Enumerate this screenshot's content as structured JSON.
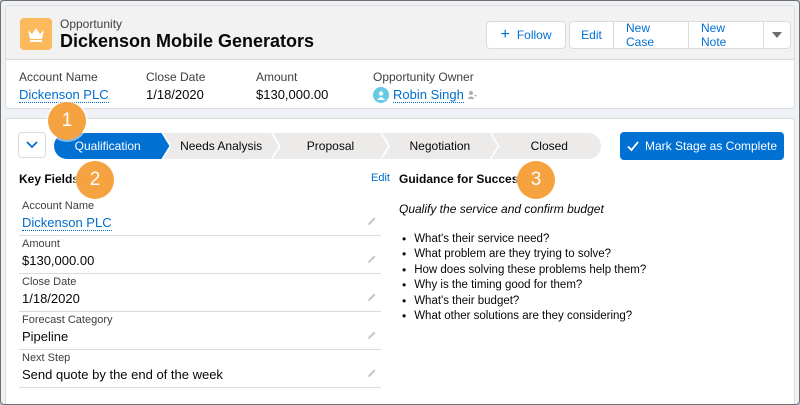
{
  "header": {
    "object_label": "Opportunity",
    "record_title": "Dickenson Mobile Generators",
    "buttons": {
      "follow": "Follow",
      "edit": "Edit",
      "new_case": "New Case",
      "new_note": "New Note"
    },
    "fields": {
      "account_name_label": "Account Name",
      "account_name_value": "Dickenson PLC",
      "close_date_label": "Close Date",
      "close_date_value": "1/18/2020",
      "amount_label": "Amount",
      "amount_value": "$130,000.00",
      "owner_label": "Opportunity Owner",
      "owner_value": "Robin Singh"
    }
  },
  "path": {
    "stages": [
      "Qualification",
      "Needs Analysis",
      "Proposal",
      "Negotiation",
      "Closed"
    ],
    "active_index": 0,
    "mark_complete_label": "Mark Stage as Complete"
  },
  "key_fields": {
    "title": "Key Fields",
    "edit_label": "Edit",
    "items": [
      {
        "label": "Account Name",
        "value": "Dickenson PLC"
      },
      {
        "label": "Amount",
        "value": "$130,000.00"
      },
      {
        "label": "Close Date",
        "value": "1/18/2020"
      },
      {
        "label": "Forecast Category",
        "value": "Pipeline"
      },
      {
        "label": "Next Step",
        "value": "Send quote by the end of the week"
      }
    ]
  },
  "guidance": {
    "title": "Guidance for Success",
    "intro": "Qualify the service and confirm budget",
    "items": [
      "What's their service need?",
      "What problem are they trying to solve?",
      "How does solving these problems help them?",
      "Why is the timing good for them?",
      "What's their budget?",
      "What other solutions are they considering?"
    ]
  },
  "callouts": [
    "1",
    "2",
    "3"
  ],
  "colors": {
    "brand": "#0070d2",
    "active_stage": "#0070d2",
    "inactive_stage": "#ecebea",
    "callout": "#f5a340",
    "app_icon": "#fcb95b",
    "link": "#006dcc"
  },
  "icons": {
    "app_icon": "crown-icon",
    "follow": "plus-icon",
    "more": "chevron-down-icon",
    "collapse": "chevron-down-icon",
    "mark_complete": "checkmark-icon",
    "field_edit": "pencil-icon",
    "owner_avatar": "user-avatar-icon",
    "change_owner": "change-owner-icon"
  }
}
